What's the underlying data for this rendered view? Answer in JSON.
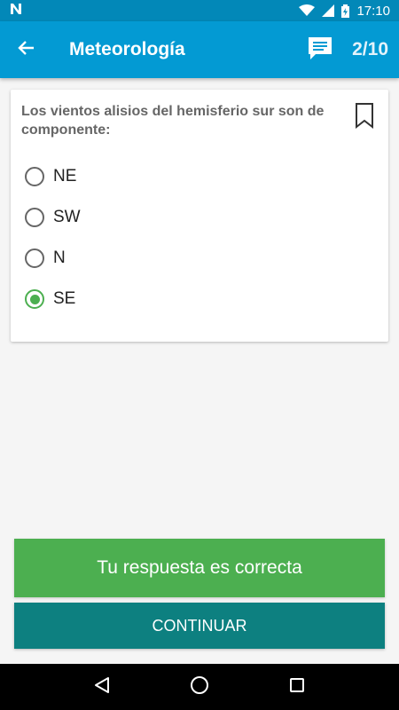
{
  "status_bar": {
    "time": "17:10",
    "notification_icon": "n-icon",
    "wifi_icon": "wifi-icon",
    "signal_icon": "signal-icon",
    "battery_icon": "battery-charging-icon"
  },
  "app_bar": {
    "title": "Meteorología",
    "back_icon": "arrow-back-icon",
    "comment_icon": "comment-icon",
    "counter": "2/10"
  },
  "question": {
    "text": "Los vientos alisios del hemisferio sur son de componente:",
    "bookmark_icon": "bookmark-icon",
    "options": [
      {
        "label": "NE",
        "selected": false
      },
      {
        "label": "SW",
        "selected": false
      },
      {
        "label": "N",
        "selected": false
      },
      {
        "label": "SE",
        "selected": true
      }
    ]
  },
  "feedback": {
    "text": "Tu respuesta es correcta",
    "color": "#4caf50"
  },
  "continue_button": {
    "label": "CONTINUAR",
    "color": "#0d8080"
  },
  "nav_bar": {
    "back_icon": "triangle-back-icon",
    "home_icon": "circle-home-icon",
    "recents_icon": "square-recents-icon"
  },
  "colors": {
    "accent": "#039ad3",
    "status_bar": "#0288b8",
    "success": "#4caf50"
  }
}
